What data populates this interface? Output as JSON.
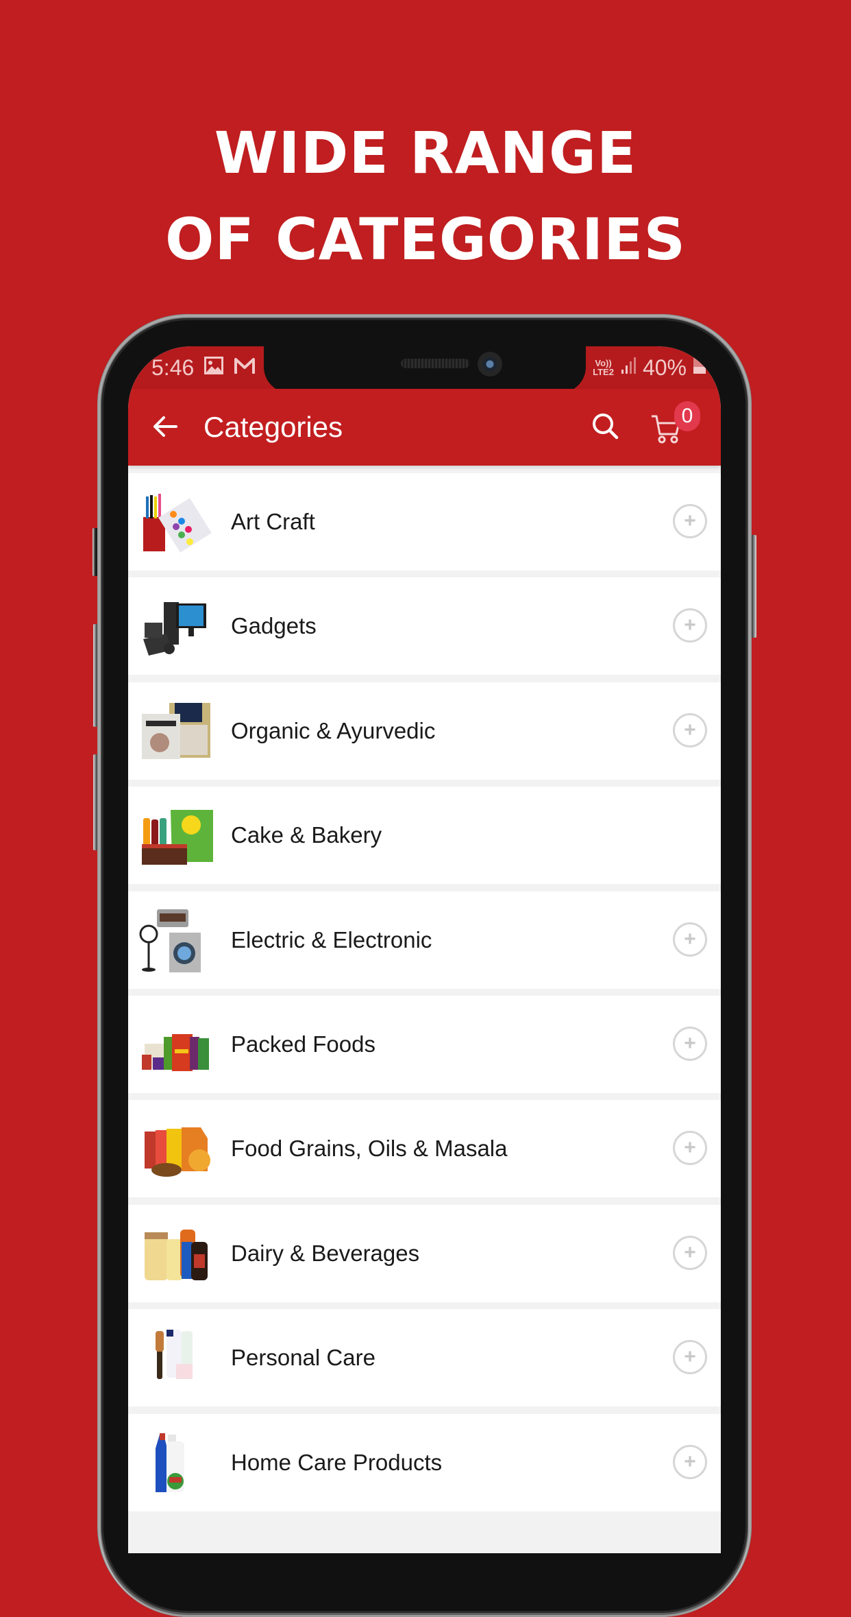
{
  "promo": {
    "headline_line1": "WIDE RANGE",
    "headline_line2": "OF CATEGORIES"
  },
  "status_bar": {
    "time": "5:46",
    "left_icons": [
      "gallery-icon",
      "gmail-icon"
    ],
    "network_top": "Vo))",
    "network_bottom": "LTE2",
    "signal_icon": "signal-icon",
    "battery_percent": "40%",
    "battery_level": 0.4
  },
  "header": {
    "title": "Categories",
    "back_icon": "arrow-left-icon",
    "search_icon": "search-icon",
    "cart_icon": "cart-icon",
    "cart_count": "0"
  },
  "categories": [
    {
      "label": "Art Craft",
      "image": "art-craft-image",
      "has_add": true
    },
    {
      "label": "Gadgets",
      "image": "gadgets-image",
      "has_add": true
    },
    {
      "label": "Organic & Ayurvedic",
      "image": "organic-image",
      "has_add": true
    },
    {
      "label": "Cake & Bakery",
      "image": "bakery-image",
      "has_add": false
    },
    {
      "label": "Electric & Electronic",
      "image": "electronics-image",
      "has_add": true
    },
    {
      "label": "Packed Foods",
      "image": "packed-foods-image",
      "has_add": true
    },
    {
      "label": "Food Grains, Oils & Masala",
      "image": "grains-image",
      "has_add": true
    },
    {
      "label": "Dairy & Beverages",
      "image": "dairy-image",
      "has_add": true
    },
    {
      "label": "Personal Care",
      "image": "personal-care-image",
      "has_add": true
    },
    {
      "label": "Home Care Products",
      "image": "home-care-image",
      "has_add": true
    }
  ],
  "add_symbol": "+",
  "colors": {
    "background": "#c01e20",
    "header": "#c21e20",
    "status_bar": "#b51b1d",
    "badge": "#e2394d",
    "list_gap": "#f2f2f2",
    "add_circle": "#d6d6d6"
  }
}
